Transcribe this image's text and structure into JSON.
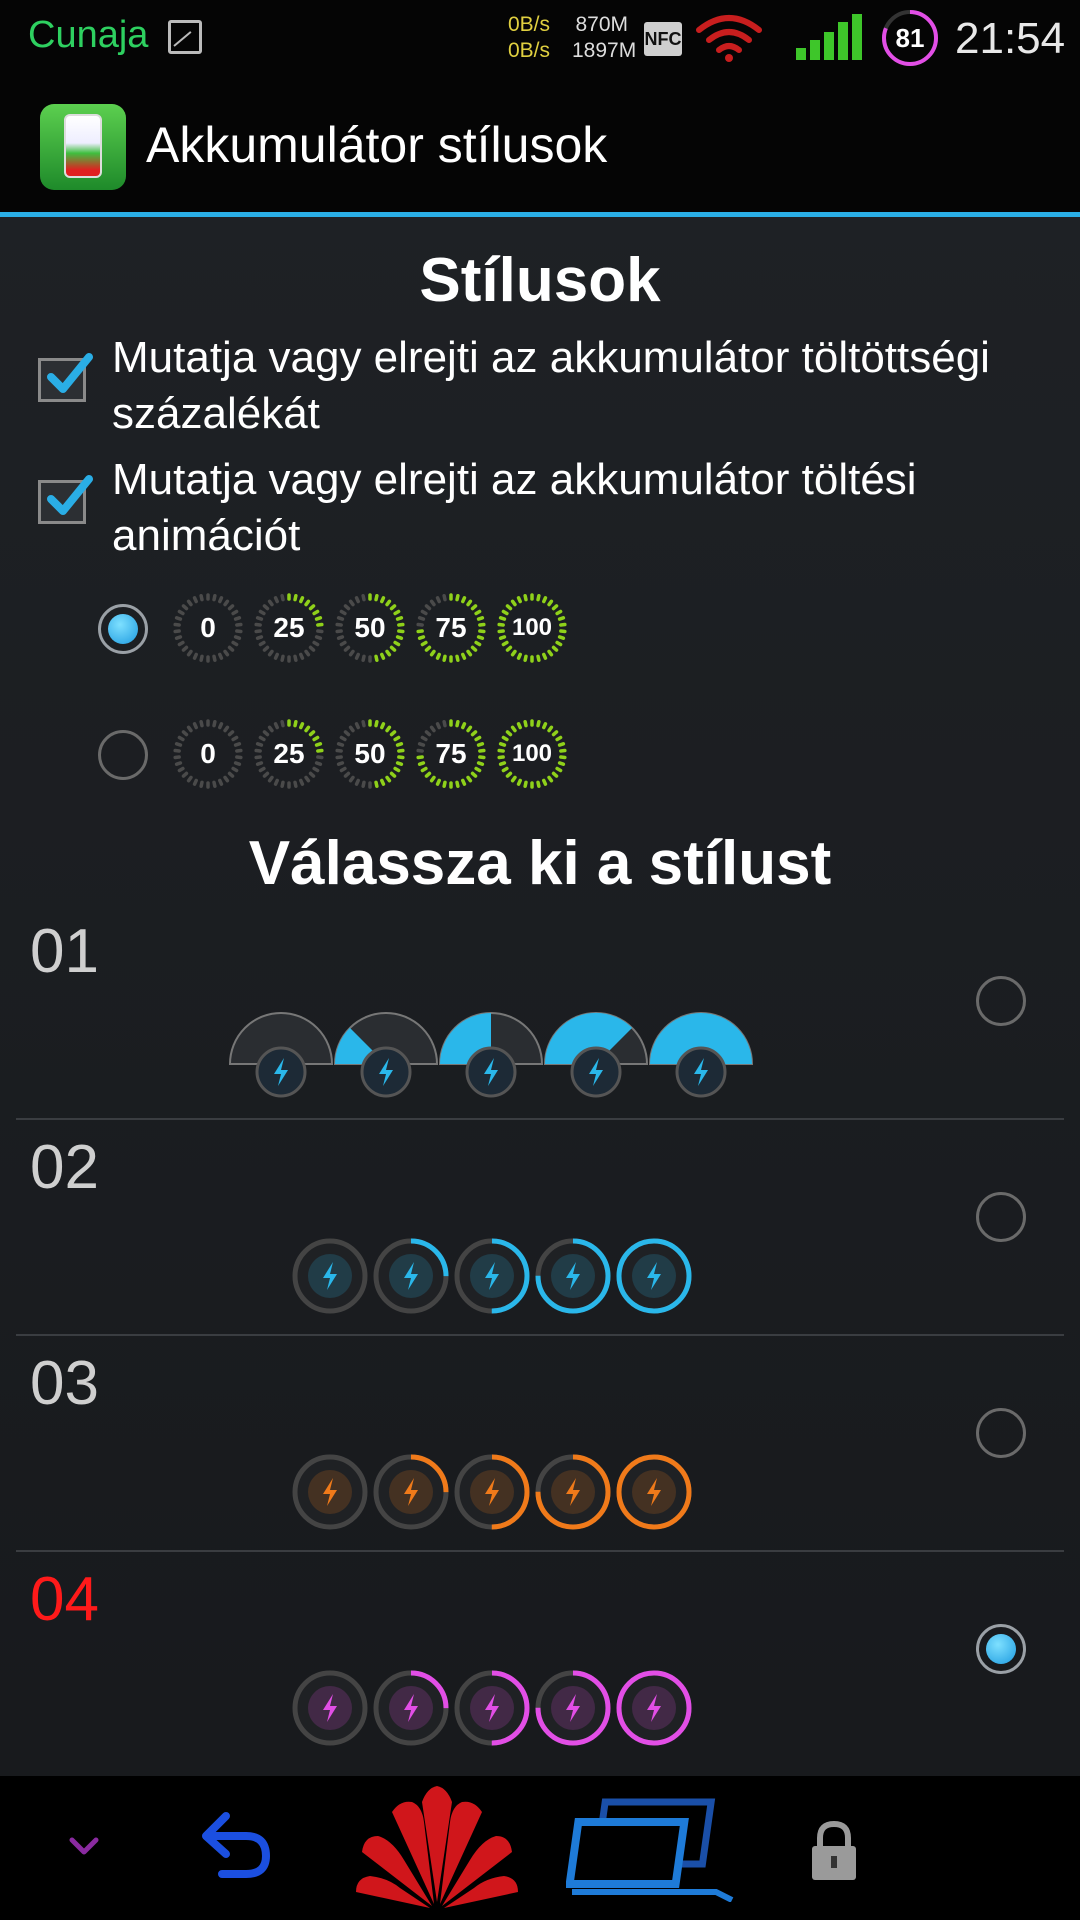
{
  "status_bar": {
    "carrier": "Cunaja",
    "net_up": "0B/s",
    "net_down": "0B/s",
    "mem_top": "870M",
    "mem_bottom": "1897M",
    "nfc_label": "NFC",
    "battery": "81",
    "time": "21:54"
  },
  "app_bar": {
    "title": "Akkumulátor stílusok"
  },
  "styles_section": {
    "title": "Stílusok",
    "options": [
      {
        "label": "Mutatja vagy elrejti az akkumulátor töltöttségi százalékát",
        "checked": true
      },
      {
        "label": "Mutatja vagy elrejti az akkumulátor töltési animációt",
        "checked": true
      }
    ],
    "percent_variants": [
      {
        "selected": true,
        "labels": [
          "0",
          "25",
          "50",
          "75",
          "100"
        ]
      },
      {
        "selected": false,
        "labels": [
          "0",
          "25",
          "50",
          "75",
          "100"
        ]
      }
    ]
  },
  "choose_section": {
    "title": "Válassza ki a stílust",
    "styles": [
      {
        "number": "01",
        "selected": false,
        "color": "#2ab7ea"
      },
      {
        "number": "02",
        "selected": false,
        "color": "#2ab7ea"
      },
      {
        "number": "03",
        "selected": false,
        "color": "#f07a1a"
      },
      {
        "number": "04",
        "selected": true,
        "color": "#e24ee6"
      }
    ]
  },
  "colors": {
    "accent": "#2aaee6",
    "selected_number": "#ff1a1a",
    "carrier": "#2ed060",
    "ring_green": "#8fd11a"
  },
  "nav_bar": {
    "icons": [
      "chevron-down-icon",
      "back-icon",
      "huawei-logo-icon",
      "recent-apps-icon",
      "lock-icon"
    ]
  }
}
